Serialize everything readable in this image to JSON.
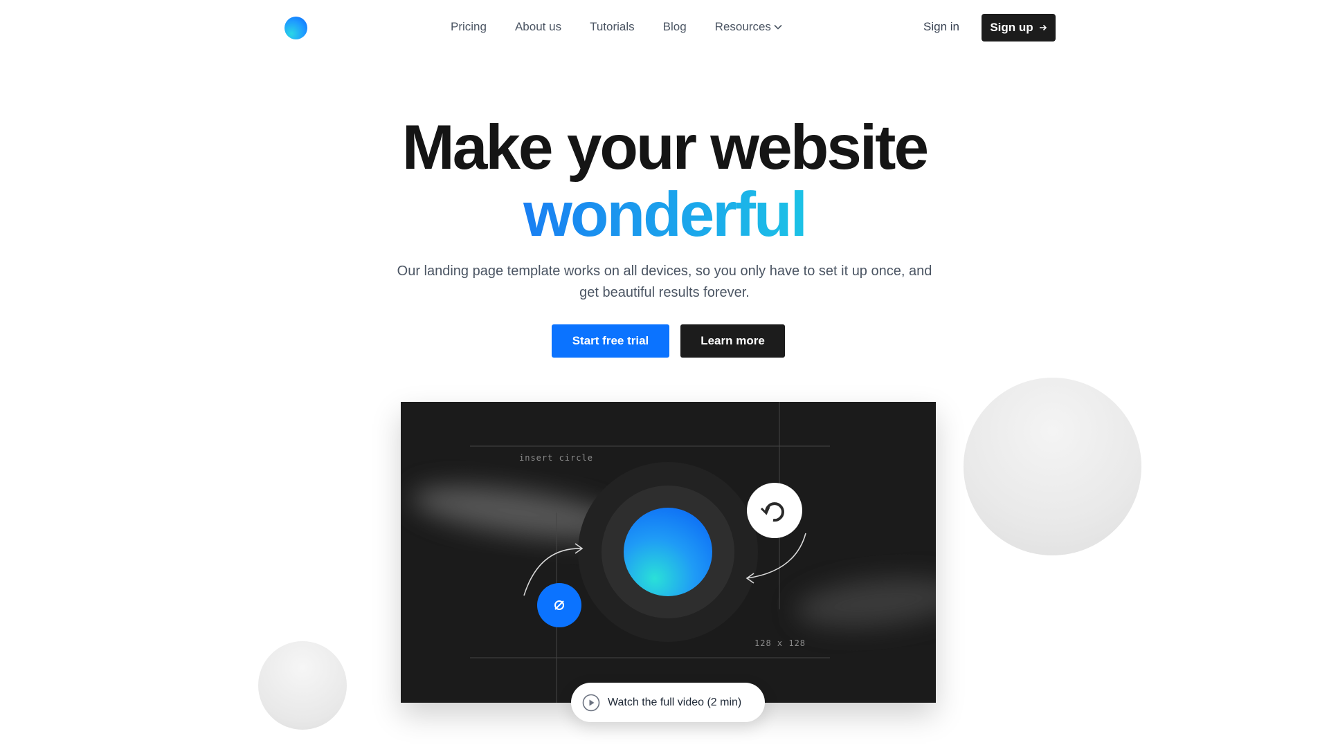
{
  "nav": {
    "items": [
      "Pricing",
      "About us",
      "Tutorials",
      "Blog"
    ],
    "resources_label": "Resources",
    "sign_in": "Sign in",
    "sign_up": "Sign up"
  },
  "hero": {
    "title_line1": "Make your website",
    "title_line2": "wonderful",
    "subtitle": "Our landing page template works on all devices, so you only have to set it up once, and get beautiful results forever.",
    "primary_cta": "Start free trial",
    "secondary_cta": "Learn more"
  },
  "video": {
    "label_insert": "insert circle",
    "label_size": "128 x 128",
    "watch_label": "Watch the full video (2 min)"
  },
  "colors": {
    "accent": "#0b73ff",
    "gradient_start": "#1a7ff2",
    "gradient_end": "#1cc2e6",
    "dark": "#1c1c1c"
  },
  "icons": [
    "logo-icon",
    "chevron-down-icon",
    "arrow-right-icon",
    "play-icon",
    "refresh-icon",
    "link-icon"
  ]
}
